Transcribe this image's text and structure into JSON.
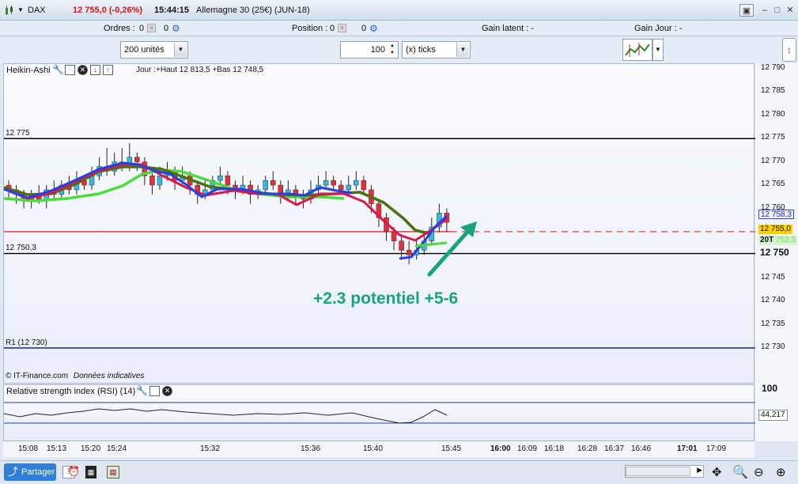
{
  "titlebar": {
    "instrument": "DAX",
    "price_change": "12 755,0 (-0,26%)",
    "time": "15:44:15",
    "description": "Allemagne 30 (25€) (JUN-18)"
  },
  "infobar": {
    "orders_label": "Ordres :",
    "orders_value": "0",
    "orders_value2": "0",
    "position_label": "Position :",
    "position_value": "0",
    "position_value2": "0",
    "gain_latent": "Gain latent :  -",
    "gain_jour": "Gain Jour :  -"
  },
  "toolbar": {
    "units_select": "200 unités",
    "ticks_value": "100",
    "ticks_select": "(x) ticks"
  },
  "chart_header": {
    "indicator": "Heikin-Ashi",
    "day_info": "Jour :+Haut 12 813,5 +Bas 12 748,5"
  },
  "levels": {
    "l12775": "12 775",
    "l12750": "12 750,3",
    "r1": "R1  (12 730)"
  },
  "annotation": "+2.3 potentiel +5-6",
  "copyright_prefix": "© IT-Finance.com",
  "copyright_suffix": "Données indicatives",
  "rsi_header": "Relative strength index (RSI) (14)",
  "y_ticks": [
    "12 790",
    "12 785",
    "12 780",
    "12 775",
    "12 770",
    "12 765",
    "12 760",
    "12 755",
    "12 750",
    "12 745",
    "12 740",
    "12 735",
    "12 730"
  ],
  "y_boxes": {
    "blue": "12 758,3",
    "yellow": "12 755,0",
    "green_prefix": "20T",
    "green_value": "752,5",
    "bold_level": "12 750"
  },
  "rsi_axis": {
    "top": "100",
    "value": "44,217"
  },
  "x_ticks": [
    "15:08",
    "15:13",
    "15:20",
    "15:24",
    "15:32",
    "15:36",
    "15:40",
    "15:45",
    "16:00",
    "16:09",
    "16:18",
    "16:28",
    "16:37",
    "16:46",
    "17:01",
    "17:09"
  ],
  "statusbar": {
    "share": "Partager"
  },
  "colors": {
    "bull": "#36b8e0",
    "bear": "#e0303a",
    "ma_red": "#d81a4a",
    "ma_blue": "#2a3ee8",
    "ma_green": "#4ddb3b",
    "ma_olive": "#4c6f10",
    "annotation": "#1aa37a",
    "price_line": "#e02828"
  },
  "chart_data": {
    "type": "candlestick",
    "y_unit": "points",
    "ylim": [
      12726,
      12792
    ],
    "x_axis": [
      "15:08",
      "15:13",
      "15:20",
      "15:24",
      "15:32",
      "15:36",
      "15:40",
      "15:45",
      "16:00",
      "16:09",
      "16:18",
      "16:28",
      "16:37",
      "16:46",
      "17:01",
      "17:09"
    ],
    "visible_lines": [
      {
        "label": "12 775",
        "value": 12775,
        "color": "#000000"
      },
      {
        "label": "12 750,3",
        "value": 12750.3,
        "color": "#000000"
      },
      {
        "label": "R1  (12 730)",
        "value": 12730,
        "color": "#1a2a8a"
      },
      {
        "label": "12 755,0",
        "value": 12755.0,
        "color": "#e02828"
      }
    ],
    "candles": [
      [
        12765,
        12764,
        12766,
        12762
      ],
      [
        12764,
        12763,
        12765,
        12761
      ],
      [
        12763,
        12762,
        12764,
        12760
      ],
      [
        12762,
        12763,
        12764,
        12760
      ],
      [
        12763,
        12762,
        12765,
        12761
      ],
      [
        12762,
        12764,
        12765,
        12760
      ],
      [
        12764,
        12763,
        12766,
        12762
      ],
      [
        12763,
        12765,
        12766,
        12762
      ],
      [
        12765,
        12764,
        12767,
        12763
      ],
      [
        12764,
        12766,
        12768,
        12763
      ],
      [
        12766,
        12765,
        12767,
        12764
      ],
      [
        12765,
        12767,
        12769,
        12764
      ],
      [
        12767,
        12769,
        12771,
        12766
      ],
      [
        12769,
        12768,
        12773,
        12767
      ],
      [
        12768,
        12770,
        12772,
        12767
      ],
      [
        12770,
        12769,
        12773,
        12768
      ],
      [
        12769,
        12771,
        12774,
        12768
      ],
      [
        12771,
        12770,
        12772,
        12768
      ],
      [
        12770,
        12767,
        12771,
        12765
      ],
      [
        12767,
        12765,
        12768,
        12763
      ],
      [
        12765,
        12767,
        12769,
        12764
      ],
      [
        12767,
        12768,
        12770,
        12766
      ],
      [
        12768,
        12766,
        12769,
        12764
      ],
      [
        12766,
        12767,
        12769,
        12765
      ],
      [
        12767,
        12765,
        12768,
        12763
      ],
      [
        12765,
        12763,
        12766,
        12761
      ],
      [
        12763,
        12764,
        12766,
        12762
      ],
      [
        12764,
        12766,
        12767,
        12763
      ],
      [
        12766,
        12767,
        12769,
        12765
      ],
      [
        12767,
        12765,
        12768,
        12763
      ],
      [
        12765,
        12764,
        12766,
        12762
      ],
      [
        12764,
        12765,
        12767,
        12763
      ],
      [
        12765,
        12763,
        12766,
        12761
      ],
      [
        12763,
        12764,
        12765,
        12762
      ],
      [
        12764,
        12766,
        12767,
        12763
      ],
      [
        12766,
        12765,
        12768,
        12764
      ],
      [
        12765,
        12763,
        12766,
        12761
      ],
      [
        12763,
        12764,
        12766,
        12762
      ],
      [
        12764,
        12763,
        12765,
        12761
      ],
      [
        12763,
        12762,
        12764,
        12760
      ],
      [
        12762,
        12764,
        12766,
        12761
      ],
      [
        12764,
        12765,
        12767,
        12763
      ],
      [
        12765,
        12766,
        12768,
        12764
      ],
      [
        12766,
        12765,
        12767,
        12764
      ],
      [
        12765,
        12764,
        12766,
        12763
      ],
      [
        12764,
        12765,
        12767,
        12763
      ],
      [
        12765,
        12766,
        12768,
        12764
      ],
      [
        12766,
        12764,
        12767,
        12763
      ],
      [
        12764,
        12761,
        12765,
        12759
      ],
      [
        12761,
        12758,
        12762,
        12756
      ],
      [
        12758,
        12755,
        12759,
        12753
      ],
      [
        12755,
        12753,
        12756,
        12751
      ],
      [
        12753,
        12751,
        12754,
        12749
      ],
      [
        12751,
        12750,
        12753,
        12748
      ],
      [
        12750,
        12751,
        12753,
        12749
      ],
      [
        12751,
        12753,
        12755,
        12750
      ],
      [
        12753,
        12756,
        12758,
        12752
      ],
      [
        12756,
        12759,
        12761,
        12755
      ],
      [
        12759,
        12757,
        12760,
        12755
      ]
    ]
  }
}
